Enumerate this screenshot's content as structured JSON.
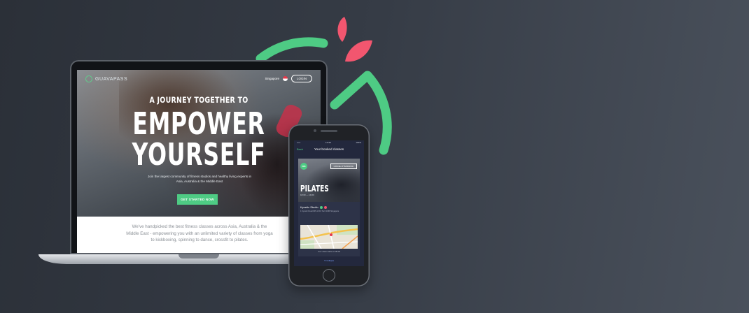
{
  "brand": {
    "colors": {
      "green": "#4ecb84",
      "pink": "#f2566f"
    },
    "logo_name": "GUAVAPASS"
  },
  "laptop": {
    "nav": {
      "location": "Singapore",
      "login_label": "LOGIN"
    },
    "hero": {
      "eyebrow": "A JOURNEY TOGETHER TO",
      "title_line1": "EMPOWER",
      "title_line2": "YOURSELF",
      "description": "Join the largest community of fitness studios and healthy living experts in Asia, Australia & the Middle East",
      "cta_label": "GET STARTED NOW"
    },
    "content": {
      "text": "We've handpicked the best fitness classes across Asia, Australia & the Middle East - empowering you with an unlimited variety of classes from yoga to kickboxing, spinning to dance, crossfit to pilates."
    }
  },
  "phone": {
    "status": {
      "carrier": "•••••",
      "time": "10:38",
      "battery": "100%"
    },
    "nav": {
      "back_label": "Back",
      "title": "Your booked classes"
    },
    "card": {
      "badge": "DIS",
      "cancel_label": "CANCEL ATTENDANCE",
      "class_name": "PILATES",
      "time": "18:30 — 19:20",
      "studio": "Kynetic Studio",
      "address": "1 Kynetic Road #05-10 Fit Tech 1068 Singapore",
      "footnote": "Your class starts at 18:30!",
      "bottom_link": "▼ Collapse"
    }
  }
}
